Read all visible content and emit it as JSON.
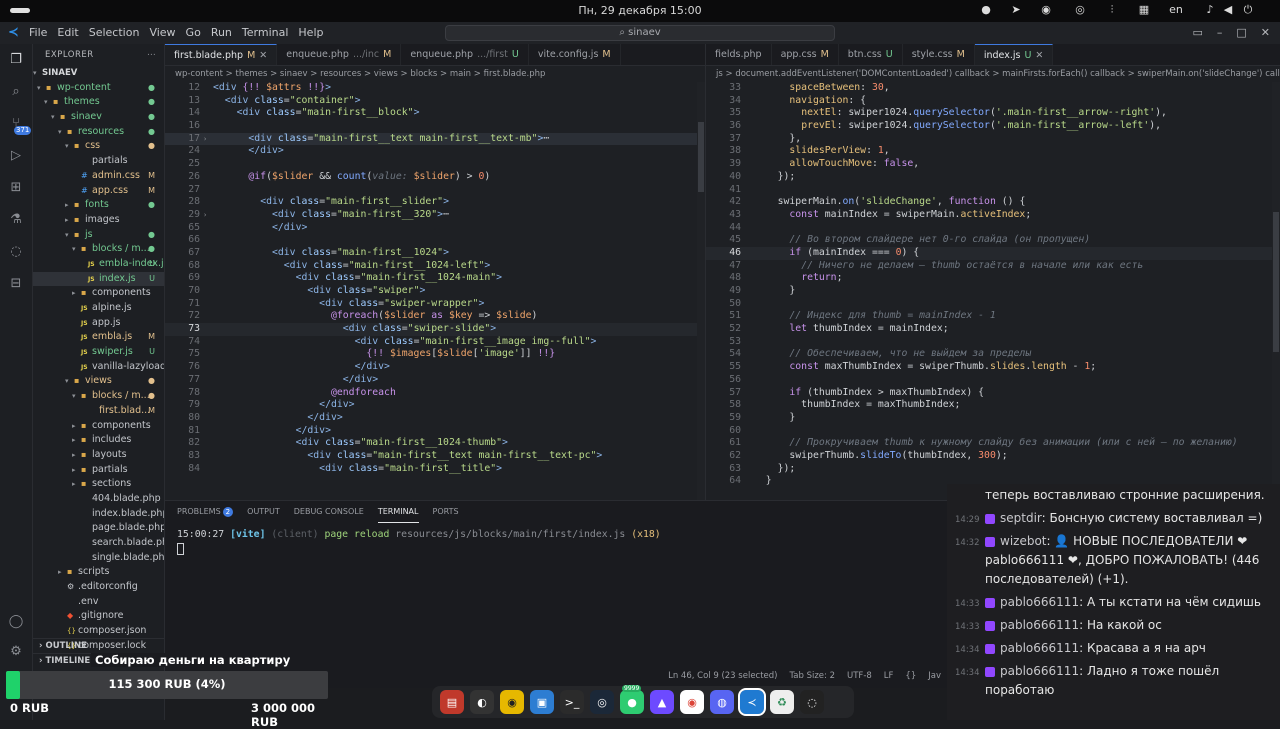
{
  "system": {
    "clock": "Пн, 29 декабря  15:00",
    "lang": "en"
  },
  "menu": {
    "items": [
      "File",
      "Edit",
      "Selection",
      "View",
      "Go",
      "Run",
      "Terminal",
      "Help"
    ],
    "search": "sinaev"
  },
  "explorer": {
    "title": "EXPLORER",
    "root": "SINAEV",
    "badge": "371",
    "rows": [
      {
        "d": 0,
        "ar": "▾",
        "ic": "📁",
        "name": "wp-content",
        "st": "●",
        "stc": "#73c991"
      },
      {
        "d": 1,
        "ar": "▾",
        "ic": "📁",
        "name": "themes",
        "st": "●",
        "stc": "#73c991"
      },
      {
        "d": 2,
        "ar": "▾",
        "ic": "📁",
        "name": "sinaev",
        "st": "●",
        "stc": "#73c991"
      },
      {
        "d": 3,
        "ar": "▾",
        "ic": "📁",
        "name": "resources",
        "st": "●",
        "stc": "#73c991"
      },
      {
        "d": 4,
        "ar": "▾",
        "ic": "📁",
        "name": "css",
        "st": "●",
        "stc": "#e2c08d"
      },
      {
        "d": 5,
        "ar": "",
        "ic": "",
        "name": "partials",
        "st": "",
        "stc": ""
      },
      {
        "d": 5,
        "ar": "",
        "ic": "#",
        "name": "admin.css",
        "st": "M",
        "stc": "#e2c08d"
      },
      {
        "d": 5,
        "ar": "",
        "ic": "#",
        "name": "app.css",
        "st": "M",
        "stc": "#e2c08d"
      },
      {
        "d": 4,
        "ar": "▸",
        "ic": "📁",
        "name": "fonts",
        "st": "●",
        "stc": "#73c991"
      },
      {
        "d": 4,
        "ar": "▸",
        "ic": "📁",
        "name": "images",
        "st": "",
        "stc": ""
      },
      {
        "d": 4,
        "ar": "▾",
        "ic": "📁",
        "name": "js",
        "st": "●",
        "stc": "#73c991"
      },
      {
        "d": 5,
        "ar": "▾",
        "ic": "📁",
        "name": "blocks / m...",
        "st": "●",
        "stc": "#73c991"
      },
      {
        "d": 6,
        "ar": "",
        "ic": "JS",
        "name": "embla-index.js",
        "st": "U",
        "stc": "#73c991"
      },
      {
        "d": 6,
        "ar": "",
        "ic": "JS",
        "name": "index.js",
        "st": "U",
        "stc": "#73c991",
        "sel": true
      },
      {
        "d": 5,
        "ar": "▸",
        "ic": "📁",
        "name": "components",
        "st": "",
        "stc": ""
      },
      {
        "d": 5,
        "ar": "",
        "ic": "JS",
        "name": "alpine.js",
        "st": "",
        "stc": ""
      },
      {
        "d": 5,
        "ar": "",
        "ic": "JS",
        "name": "app.js",
        "st": "",
        "stc": ""
      },
      {
        "d": 5,
        "ar": "",
        "ic": "JS",
        "name": "embla.js",
        "st": "M",
        "stc": "#e2c08d"
      },
      {
        "d": 5,
        "ar": "",
        "ic": "JS",
        "name": "swiper.js",
        "st": "U",
        "stc": "#73c991"
      },
      {
        "d": 5,
        "ar": "",
        "ic": "JS",
        "name": "vanilla-lazyload.js",
        "st": "",
        "stc": ""
      },
      {
        "d": 4,
        "ar": "▾",
        "ic": "📁",
        "name": "views",
        "st": "●",
        "stc": "#e2c08d"
      },
      {
        "d": 5,
        "ar": "▾",
        "ic": "📁",
        "name": "blocks / m...",
        "st": "●",
        "stc": "#e2c08d"
      },
      {
        "d": 6,
        "ar": "",
        "ic": "",
        "name": "first.blad...",
        "st": "M",
        "stc": "#e2c08d"
      },
      {
        "d": 5,
        "ar": "▸",
        "ic": "📁",
        "name": "components",
        "st": "",
        "stc": ""
      },
      {
        "d": 5,
        "ar": "▸",
        "ic": "📁",
        "name": "includes",
        "st": "",
        "stc": ""
      },
      {
        "d": 5,
        "ar": "▸",
        "ic": "📁",
        "name": "layouts",
        "st": "",
        "stc": ""
      },
      {
        "d": 5,
        "ar": "▸",
        "ic": "📁",
        "name": "partials",
        "st": "",
        "stc": ""
      },
      {
        "d": 5,
        "ar": "▸",
        "ic": "📁",
        "name": "sections",
        "st": "",
        "stc": ""
      },
      {
        "d": 5,
        "ar": "",
        "ic": "",
        "name": "404.blade.php",
        "st": "",
        "stc": ""
      },
      {
        "d": 5,
        "ar": "",
        "ic": "",
        "name": "index.blade.php",
        "st": "",
        "stc": ""
      },
      {
        "d": 5,
        "ar": "",
        "ic": "",
        "name": "page.blade.php",
        "st": "",
        "stc": ""
      },
      {
        "d": 5,
        "ar": "",
        "ic": "",
        "name": "search.blade.php",
        "st": "",
        "stc": ""
      },
      {
        "d": 5,
        "ar": "",
        "ic": "",
        "name": "single.blade.php",
        "st": "",
        "stc": ""
      },
      {
        "d": 3,
        "ar": "▸",
        "ic": "📁",
        "name": "scripts",
        "st": "",
        "stc": ""
      },
      {
        "d": 3,
        "ar": "",
        "ic": "⚙",
        "name": ".editorconfig",
        "st": "",
        "stc": ""
      },
      {
        "d": 3,
        "ar": "",
        "ic": "",
        "name": ".env",
        "st": "",
        "stc": ""
      },
      {
        "d": 3,
        "ar": "",
        "ic": "◆",
        "name": ".gitignore",
        "st": "",
        "stc": ""
      },
      {
        "d": 3,
        "ar": "",
        "ic": "{}",
        "name": "composer.json",
        "st": "",
        "stc": ""
      },
      {
        "d": 3,
        "ar": "",
        "ic": "{}",
        "name": "composer.lock",
        "st": "",
        "stc": ""
      }
    ],
    "outline": "OUTLINE",
    "timeline": "TIMELINE"
  },
  "left_editor": {
    "tabs": [
      {
        "label": "first.blade.php",
        "status": "M",
        "active": true
      },
      {
        "label": "enqueue.php",
        "sub": ".../inc",
        "status": "M"
      },
      {
        "label": "enqueue.php",
        "sub": ".../first",
        "status": "U"
      },
      {
        "label": "vite.config.js",
        "status": "M"
      }
    ],
    "crumbs": "wp-content  >  themes  >  sinaev  >  resources  >  views  >  blocks  >  main  >  first.blade.php",
    "lines": [
      {
        "n": "12",
        "h": "<span class=\"tag\">&lt;div</span> <span class=\"kw\">{!!</span> <span class=\"var\">$attrs</span> <span class=\"kw\">!!}</span><span class=\"tag\">&gt;</span>"
      },
      {
        "n": "13",
        "h": "  <span class=\"tag\">&lt;div</span> <span class=\"attr\">class</span>=<span class=\"str\">\"container\"</span><span class=\"tag\">&gt;</span>"
      },
      {
        "n": "14",
        "h": "    <span class=\"tag\">&lt;div</span> <span class=\"attr\">class</span>=<span class=\"str\">\"main-first__block\"</span><span class=\"tag\">&gt;</span>"
      },
      {
        "n": "16",
        "h": ""
      },
      {
        "n": "17",
        "h": "      <span class=\"tag\">&lt;div</span> <span class=\"attr\">class</span>=<span class=\"str\">\"main-first__text main-first__text-mb\"</span><span class=\"tag\">&gt;</span>⋯",
        "hl": true,
        "g": "›"
      },
      {
        "n": "24",
        "h": "      <span class=\"tag\">&lt;/div&gt;</span>"
      },
      {
        "n": "25",
        "h": ""
      },
      {
        "n": "26",
        "h": "      <span class=\"kw\">@if</span>(<span class=\"var\">$slider</span> &amp;&amp; <span class=\"fn\">count</span>(<span class=\"cm\">value:</span> <span class=\"var\">$slider</span>) &gt; <span class=\"num2\">0</span>)"
      },
      {
        "n": "27",
        "h": ""
      },
      {
        "n": "28",
        "h": "        <span class=\"tag\">&lt;div</span> <span class=\"attr\">class</span>=<span class=\"str\">\"main-first__slider\"</span><span class=\"tag\">&gt;</span>"
      },
      {
        "n": "29",
        "h": "          <span class=\"tag\">&lt;div</span> <span class=\"attr\">class</span>=<span class=\"str\">\"main-first__320\"</span><span class=\"tag\">&gt;</span>⋯",
        "g": "›"
      },
      {
        "n": "65",
        "h": "          <span class=\"tag\">&lt;/div&gt;</span>"
      },
      {
        "n": "66",
        "h": ""
      },
      {
        "n": "67",
        "h": "          <span class=\"tag\">&lt;div</span> <span class=\"attr\">class</span>=<span class=\"str\">\"main-first__1024\"</span><span class=\"tag\">&gt;</span>"
      },
      {
        "n": "68",
        "h": "            <span class=\"tag\">&lt;div</span> <span class=\"attr\">class</span>=<span class=\"str\">\"main-first__1024-left\"</span><span class=\"tag\">&gt;</span>"
      },
      {
        "n": "69",
        "h": "              <span class=\"tag\">&lt;div</span> <span class=\"attr\">class</span>=<span class=\"str\">\"main-first__1024-main\"</span><span class=\"tag\">&gt;</span>"
      },
      {
        "n": "70",
        "h": "                <span class=\"tag\">&lt;div</span> <span class=\"attr\">class</span>=<span class=\"str\">\"swiper\"</span><span class=\"tag\">&gt;</span>"
      },
      {
        "n": "71",
        "h": "                  <span class=\"tag\">&lt;div</span> <span class=\"attr\">class</span>=<span class=\"str\">\"swiper-wrapper\"</span><span class=\"tag\">&gt;</span>"
      },
      {
        "n": "72",
        "h": "                    <span class=\"kw\">@foreach</span>(<span class=\"var\">$slider</span> <span class=\"kw\">as</span> <span class=\"var\">$key</span> =&gt; <span class=\"var\">$slide</span>)"
      },
      {
        "n": "73",
        "h": "                      <span class=\"tag\">&lt;div</span> <span class=\"attr\">class</span>=<span class=\"str\">\"swiper-slide\"</span><span class=\"tag\">&gt;</span>",
        "cur": true
      },
      {
        "n": "74",
        "h": "                        <span class=\"tag\">&lt;div</span> <span class=\"attr\">class</span>=<span class=\"str\">\"main-first__image img--full\"</span><span class=\"tag\">&gt;</span>"
      },
      {
        "n": "75",
        "h": "                          <span class=\"kw\">{!!</span> <span class=\"var\">$images</span>[<span class=\"var\">$slide</span>[<span class=\"str\">'image'</span>]] <span class=\"kw\">!!}</span>"
      },
      {
        "n": "76",
        "h": "                        <span class=\"tag\">&lt;/div&gt;</span>"
      },
      {
        "n": "77",
        "h": "                      <span class=\"tag\">&lt;/div&gt;</span>"
      },
      {
        "n": "78",
        "h": "                    <span class=\"kw\">@endforeach</span>"
      },
      {
        "n": "79",
        "h": "                  <span class=\"tag\">&lt;/div&gt;</span>"
      },
      {
        "n": "80",
        "h": "                <span class=\"tag\">&lt;/div&gt;</span>"
      },
      {
        "n": "81",
        "h": "              <span class=\"tag\">&lt;/div&gt;</span>"
      },
      {
        "n": "82",
        "h": "              <span class=\"tag\">&lt;div</span> <span class=\"attr\">class</span>=<span class=\"str\">\"main-first__1024-thumb\"</span><span class=\"tag\">&gt;</span>"
      },
      {
        "n": "83",
        "h": "                <span class=\"tag\">&lt;div</span> <span class=\"attr\">class</span>=<span class=\"str\">\"main-first__text main-first__text-pc\"</span><span class=\"tag\">&gt;</span>"
      },
      {
        "n": "84",
        "h": "                  <span class=\"tag\">&lt;div</span> <span class=\"attr\">class</span>=<span class=\"str\">\"main-first__title\"</span><span class=\"tag\">&gt;</span>"
      }
    ]
  },
  "right_editor": {
    "tabs": [
      {
        "label": "fields.php",
        "status": ""
      },
      {
        "label": "app.css",
        "status": "M"
      },
      {
        "label": "btn.css",
        "status": "U"
      },
      {
        "label": "style.css",
        "status": "M"
      },
      {
        "label": "index.js",
        "status": "U",
        "active": true
      }
    ],
    "crumbs": "js  >  document.addEventListener('DOMContentLoaded') callback  >  mainFirsts.forEach() callback  >  swiperMain.on('slideChange') callback",
    "lines": [
      {
        "n": "33",
        "h": "      <span class=\"prop\">spaceBetween</span>: <span class=\"num2\">30</span>,"
      },
      {
        "n": "34",
        "h": "      <span class=\"prop\">navigation</span>: {"
      },
      {
        "n": "35",
        "h": "        <span class=\"prop\">nextEl</span>: swiper1024.<span class=\"fn\">querySelector</span>(<span class=\"str\">'.main-first__arrow--right'</span>),"
      },
      {
        "n": "36",
        "h": "        <span class=\"prop\">prevEl</span>: swiper1024.<span class=\"fn\">querySelector</span>(<span class=\"str\">'.main-first__arrow--left'</span>),"
      },
      {
        "n": "37",
        "h": "      },"
      },
      {
        "n": "38",
        "h": "      <span class=\"prop\">slidesPerView</span>: <span class=\"num2\">1</span>,"
      },
      {
        "n": "39",
        "h": "      <span class=\"prop\">allowTouchMove</span>: <span class=\"kw\">false</span>,"
      },
      {
        "n": "40",
        "h": "    });"
      },
      {
        "n": "41",
        "h": ""
      },
      {
        "n": "42",
        "h": "    swiperMain.<span class=\"fn\">on</span>(<span class=\"str\">'slideChange'</span>, <span class=\"kw\">function</span> () {"
      },
      {
        "n": "43",
        "h": "      <span class=\"kw\">const</span> mainIndex = swiperMain.<span class=\"prop\">activeIndex</span>;"
      },
      {
        "n": "44",
        "h": ""
      },
      {
        "n": "45",
        "h": "      <span class=\"cm\">// Во втором слайдере нет 0-го слайда (он пропущен)</span>"
      },
      {
        "n": "46",
        "h": "      <span class=\"kw\">if</span> (mainIndex === <span class=\"num2\">0</span>) {",
        "cur": true
      },
      {
        "n": "47",
        "h": "        <span class=\"cm\">// Ничего не делаем — thumb остаётся в начале или как есть</span>"
      },
      {
        "n": "48",
        "h": "        <span class=\"kw\">return</span>;"
      },
      {
        "n": "49",
        "h": "      }"
      },
      {
        "n": "50",
        "h": ""
      },
      {
        "n": "51",
        "h": "      <span class=\"cm\">// Индекс для thumb = mainIndex - 1</span>"
      },
      {
        "n": "52",
        "h": "      <span class=\"kw\">let</span> thumbIndex = mainIndex;"
      },
      {
        "n": "53",
        "h": ""
      },
      {
        "n": "54",
        "h": "      <span class=\"cm\">// Обеспечиваем, что не выйдем за пределы</span>"
      },
      {
        "n": "55",
        "h": "      <span class=\"kw\">const</span> maxThumbIndex = swiperThumb.<span class=\"prop\">slides</span>.<span class=\"prop\">length</span> - <span class=\"num2\">1</span>;"
      },
      {
        "n": "56",
        "h": ""
      },
      {
        "n": "57",
        "h": "      <span class=\"kw\">if</span> (thumbIndex &gt; maxThumbIndex) {"
      },
      {
        "n": "58",
        "h": "        thumbIndex = maxThumbIndex;"
      },
      {
        "n": "59",
        "h": "      }"
      },
      {
        "n": "60",
        "h": ""
      },
      {
        "n": "61",
        "h": "      <span class=\"cm\">// Прокручиваем thumb к нужному слайду без анимации (или с ней — по желанию)</span>"
      },
      {
        "n": "62",
        "h": "      swiperThumb.<span class=\"fn\">slideTo</span>(thumbIndex, <span class=\"num2\">300</span>);"
      },
      {
        "n": "63",
        "h": "    });"
      },
      {
        "n": "64",
        "h": "  }"
      }
    ]
  },
  "panel": {
    "tabs": [
      "PROBLEMS",
      "OUTPUT",
      "DEBUG CONSOLE",
      "TERMINAL",
      "PORTS"
    ],
    "problems_count": "2",
    "active": "TERMINAL",
    "log_time": "15:00:27",
    "log_tag": "[vite]",
    "log_client": "(client)",
    "log_msg": "page reload",
    "log_path": "resources/js/blocks/main/first/index.js",
    "log_count": "(x18)"
  },
  "status": {
    "cursor": "Ln 46, Col 9 (23 selected)",
    "tab": "Tab Size: 2",
    "enc": "UTF-8",
    "eol": "LF",
    "lang": "Jav"
  },
  "chat": [
    {
      "t": "",
      "user": "",
      "text": "теперь воставливаю стронние расширения."
    },
    {
      "t": "14:29",
      "user": "septdir",
      "text": "Бонсную систему воставливал =)"
    },
    {
      "t": "14:32",
      "user": "wizebot",
      "text": "👤 НОВЫЕ ПОСЛЕДОВАТЕЛИ ❤ pablo666111 ❤, ДОБРО ПОЖАЛОВАТЬ! (446 последователей) (+1)."
    },
    {
      "t": "14:33",
      "user": "pablo666111",
      "text": "А ты кстати на чём сидишь"
    },
    {
      "t": "14:33",
      "user": "pablo666111",
      "text": "На какой ос"
    },
    {
      "t": "14:34",
      "user": "pablo666111",
      "text": "Красава а я на арч"
    },
    {
      "t": "14:34",
      "user": "pablo666111",
      "text": "Ладно я тоже пошёл поработаю"
    }
  ],
  "donate": {
    "title": "Собираю деньги на квартиру",
    "current": "115 300 RUB (4%)",
    "min": "0 RUB",
    "max": "3 000 000 RUB",
    "progress": 0.04,
    "bar_color": "#1fd26a"
  },
  "dock": {
    "badge": "9999",
    "items": [
      "files-icon",
      "github-icon",
      "oni-icon",
      "store-icon",
      "terminal-icon",
      "steam-icon",
      "chat-icon",
      "proton-icon",
      "chrome-icon",
      "discord-icon",
      "vscode-icon",
      "recycle-icon",
      "obs-icon"
    ]
  }
}
